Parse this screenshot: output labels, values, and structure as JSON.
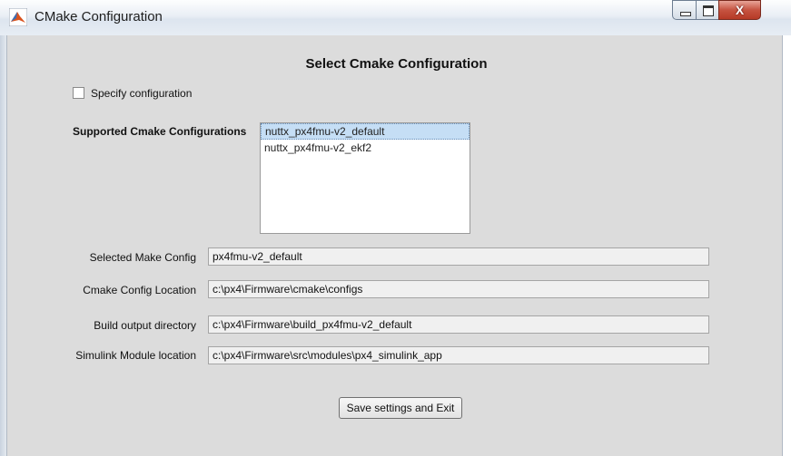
{
  "window": {
    "title": "CMake Configuration",
    "icon": "matlab-icon",
    "controls": {
      "minimize": "minimize-icon",
      "maximize": "maximize-icon",
      "close": "X"
    }
  },
  "heading": "Select Cmake Configuration",
  "specify_config": {
    "label": "Specify configuration",
    "checked": false
  },
  "supported_configs": {
    "label": "Supported Cmake Configurations",
    "items": [
      {
        "label": "nuttx_px4fmu-v2_default",
        "selected": true
      },
      {
        "label": "nuttx_px4fmu-v2_ekf2",
        "selected": false
      }
    ]
  },
  "fields": [
    {
      "label": "Selected Make Config",
      "value": "px4fmu-v2_default"
    },
    {
      "label": "Cmake Config Location",
      "value": "c:\\px4\\Firmware\\cmake\\configs"
    },
    {
      "label": "Build output directory",
      "value": "c:\\px4\\Firmware\\build_px4fmu-v2_default"
    },
    {
      "label": "Simulink Module location",
      "value": "c:\\px4\\Firmware\\src\\modules\\px4_simulink_app"
    }
  ],
  "save_button": {
    "label": "Save settings and Exit"
  },
  "colors": {
    "selection": "#c5def5",
    "background": "#dcdcdc",
    "close_button": "#c65341"
  }
}
